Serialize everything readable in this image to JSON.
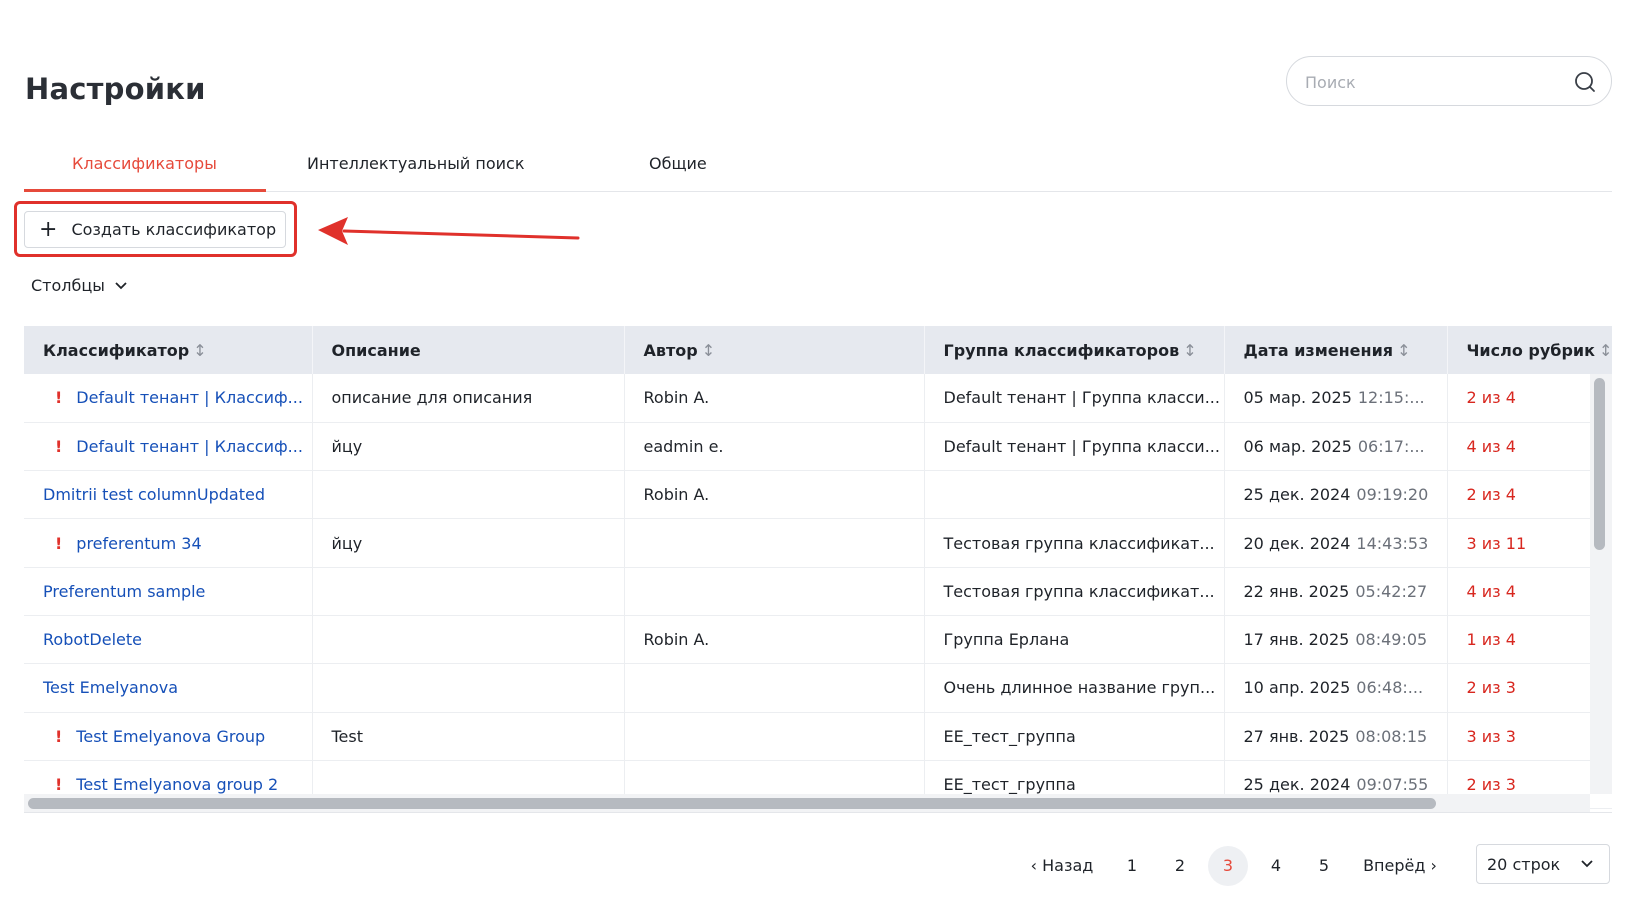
{
  "page": {
    "title": "Настройки"
  },
  "search": {
    "placeholder": "Поиск",
    "icon": "search-icon"
  },
  "tabs": [
    {
      "label": "Классификаторы",
      "active": true
    },
    {
      "label": "Интеллектуальный поиск",
      "active": false
    },
    {
      "label": "Общие",
      "active": false
    }
  ],
  "toolbar": {
    "create_label": "Создать классификатор",
    "create_icon": "plus-icon",
    "columns_label": "Столбцы"
  },
  "colors": {
    "accent": "#e64a3b",
    "link": "#1650b8",
    "warning": "#e0312b",
    "highlight": "#e0312b"
  },
  "table": {
    "columns": [
      {
        "label": "Классификатор",
        "sortable": true
      },
      {
        "label": "Описание",
        "sortable": false
      },
      {
        "label": "Автор",
        "sortable": true
      },
      {
        "label": "Группа классификаторов",
        "sortable": true
      },
      {
        "label": "Дата изменения",
        "sortable": true
      },
      {
        "label": "Число рубрик",
        "sortable": true
      }
    ],
    "sort_glyph": "↕",
    "warn_glyph": "!",
    "rows": [
      {
        "warn": true,
        "name": "Default тенант | Классиф...",
        "description": "описание для описания",
        "author": "Robin A.",
        "group": "Default тенант | Группа класси...",
        "date": "05 мар. 2025",
        "time": "12:15:...",
        "count": "2 из 4"
      },
      {
        "warn": true,
        "name": "Default тенант | Классиф...",
        "description": "йцу",
        "author": "eadmin e.",
        "group": "Default тенант | Группа класси...",
        "date": "06 мар. 2025",
        "time": "06:17:...",
        "count": "4 из 4"
      },
      {
        "warn": false,
        "name": "Dmitrii test columnUpdated",
        "description": "",
        "author": "Robin A.",
        "group": "",
        "date": "25 дек. 2024",
        "time": "09:19:20",
        "count": "2 из 4"
      },
      {
        "warn": true,
        "name": "preferentum 34",
        "description": "йцу",
        "author": "",
        "group": "Тестовая группа классификат...",
        "date": "20 дек. 2024",
        "time": "14:43:53",
        "count": "3 из 11"
      },
      {
        "warn": false,
        "name": "Preferentum sample",
        "description": "",
        "author": "",
        "group": "Тестовая группа классификат...",
        "date": "22 янв. 2025",
        "time": "05:42:27",
        "count": "4 из 4"
      },
      {
        "warn": false,
        "name": "RobotDelete",
        "description": "",
        "author": "Robin A.",
        "group": "Группа Ерлана",
        "date": "17 янв. 2025",
        "time": "08:49:05",
        "count": "1 из 4"
      },
      {
        "warn": false,
        "name": "Test Emelyanova",
        "description": "",
        "author": "",
        "group": "Очень длинное название груп...",
        "date": "10 апр. 2025",
        "time": "06:48:...",
        "count": "2 из 3"
      },
      {
        "warn": true,
        "name": "Test Emelyanova Group",
        "description": "Test",
        "author": "",
        "group": "ЕЕ_тест_группа",
        "date": "27 янв. 2025",
        "time": "08:08:15",
        "count": "3 из 3"
      },
      {
        "warn": true,
        "name": "Test Emelyanova group 2",
        "description": "",
        "author": "",
        "group": "ЕЕ_тест_группа",
        "date": "25 дек. 2024",
        "time": "09:07:55",
        "count": "2 из 3"
      }
    ]
  },
  "pagination": {
    "prev_label": "‹ Назад",
    "next_label": "Вперёд ›",
    "pages": [
      "1",
      "2",
      "3",
      "4",
      "5"
    ],
    "current": "3",
    "rows_per_page": "20 строк"
  }
}
